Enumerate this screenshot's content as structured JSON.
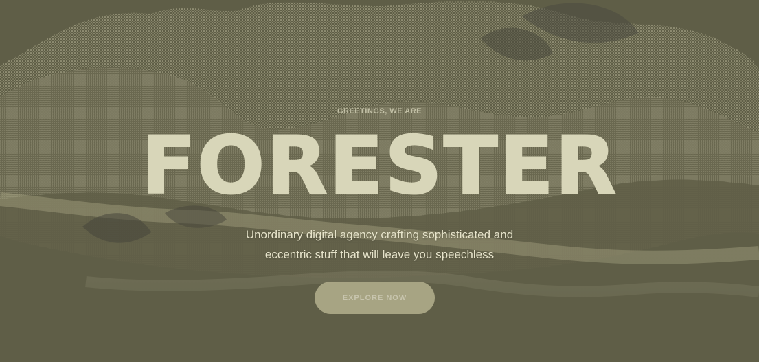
{
  "hero": {
    "eyebrow": "GREETINGS, WE ARE",
    "title": "FORESTER",
    "subtitle_lines": [
      "Unordinary digital agency crafting sophisticated and",
      "eccentric stuff that will leave you speechless"
    ],
    "cta_label": "EXPLORE NOW"
  },
  "colors": {
    "background": "#5f5e47",
    "light": "#d7d5b8",
    "button": "#b2ae8c"
  }
}
